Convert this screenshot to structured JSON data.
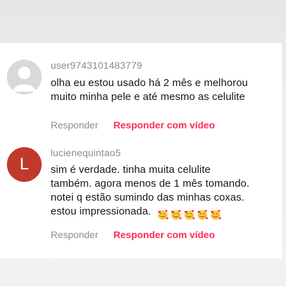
{
  "comments": [
    {
      "username": "user9743101483779",
      "avatar": "default-avatar",
      "lines": [
        "olha eu estou usado há 2 mês e melhorou",
        "muito minha pele e até mesmo as celulite"
      ],
      "reply_label": "Responder",
      "reply_video_label": "Responder com vídeo"
    },
    {
      "username": "lucienequintao5",
      "avatar_letter": "L",
      "lines": [
        "sim é verdade. tinha muita celulite",
        "também. agora menos de 1 mês tomando.",
        "notei q estão sumindo das minhas coxas.",
        "estou impressionada."
      ],
      "emojis": [
        "smiling-face-with-hearts",
        "smiling-face-with-hearts",
        "smiling-face-with-hearts",
        "smiling-face-with-hearts",
        "smiling-face-with-hearts"
      ],
      "reply_label": "Responder",
      "reply_video_label": "Responder com vídeo"
    }
  ],
  "colors": {
    "accent": "#fe2c55",
    "avatar_letter_bg": "#c0392b"
  }
}
